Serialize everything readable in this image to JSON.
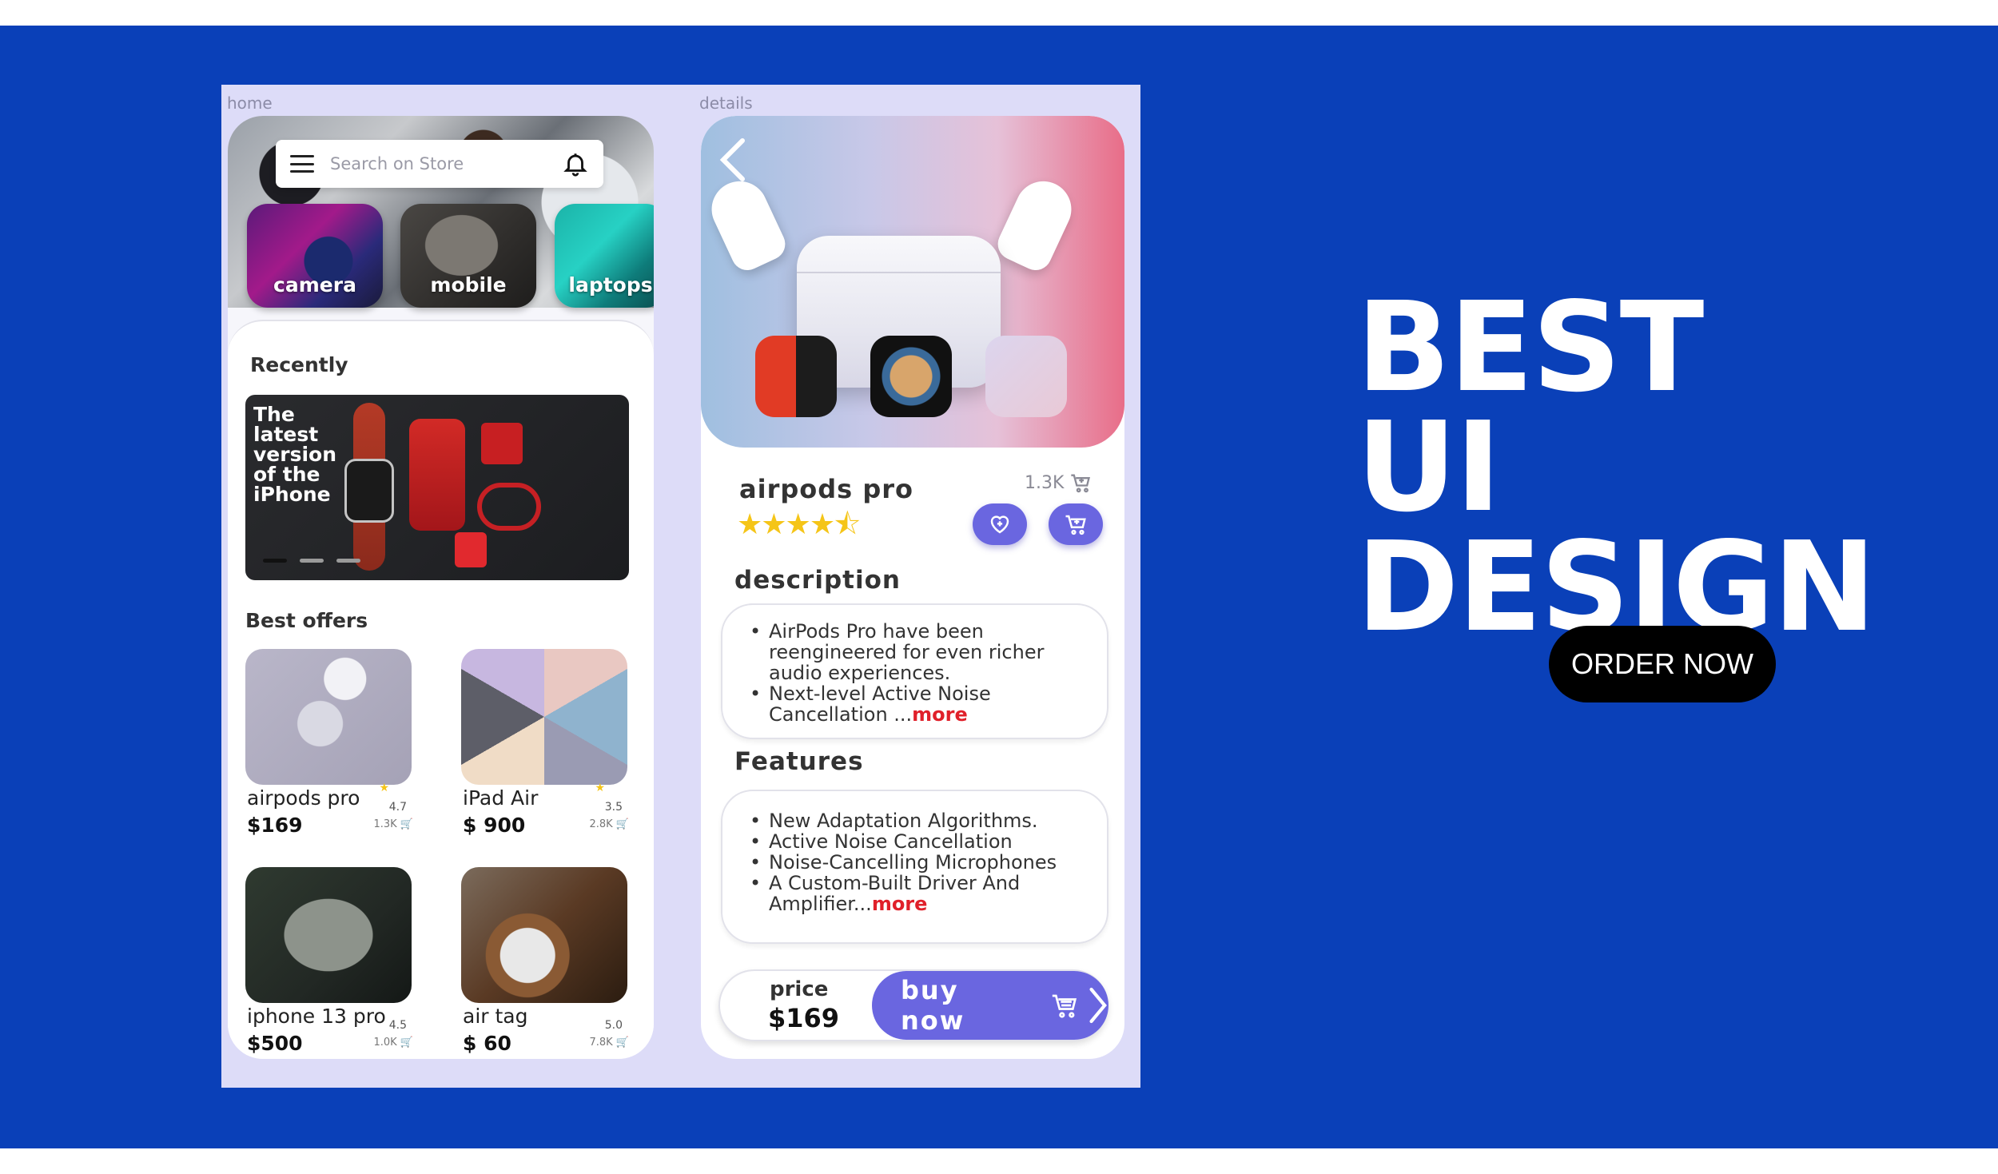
{
  "frame_labels": {
    "home": "home",
    "details": "details"
  },
  "home": {
    "search": {
      "placeholder": "Search on Store"
    },
    "categories": [
      {
        "label": "camera"
      },
      {
        "label": "mobile"
      },
      {
        "label": "laptops"
      }
    ],
    "recently": {
      "title": "Recently",
      "banner_text": "The latest version of the iPhone"
    },
    "best_offers": {
      "title": "Best offers",
      "items": [
        {
          "name": "airpods pro",
          "price": "$169",
          "rating": "4.7",
          "sold": "1.3K"
        },
        {
          "name": "iPad Air",
          "price": "$ 900",
          "rating": "3.5",
          "sold": "2.8K"
        },
        {
          "name": "iphone 13 pro",
          "price": "$500",
          "rating": "4.5",
          "sold": "1.0K"
        },
        {
          "name": "air tag",
          "price": "$ 60",
          "rating": "5.0",
          "sold": "7.8K"
        }
      ]
    }
  },
  "details": {
    "title": "airpods pro",
    "sold": "1.3K",
    "rating_stars": "★★★★⯪",
    "description": {
      "title": "description",
      "items": [
        "AirPods Pro have been reengineered for even richer audio experiences.",
        "Next-level Active Noise Cancellation ..."
      ],
      "more": "more"
    },
    "features": {
      "title": "Features",
      "items": [
        "New Adaptation Algorithms.",
        "Active Noise Cancellation",
        "Noise-Cancelling Microphones",
        "A Custom-Built Driver And Amplifier..."
      ],
      "more": "more"
    },
    "price_label": "price",
    "price": "$169",
    "buy_label": "buy now"
  },
  "headline": {
    "line1": "BEST",
    "line2": "UI DESIGN"
  },
  "cta": {
    "label": "ORDER NOW"
  },
  "colors": {
    "background": "#0a40b8",
    "accent": "#6a66e0",
    "more": "#e0202a",
    "star": "#f5c518"
  }
}
